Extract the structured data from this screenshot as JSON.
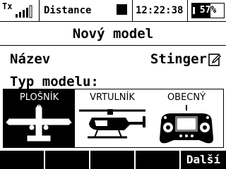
{
  "status": {
    "tx_label": "Tx",
    "signal_bars": 4,
    "title": "Distance",
    "clock": "12:22:38",
    "battery_percent": "57%",
    "battery_level": 0.57
  },
  "screen": {
    "title": "Nový model"
  },
  "model": {
    "name_label": "Název",
    "name_value": "Stinger"
  },
  "model_type": {
    "label": "Typ modelu:",
    "selected": "PLOŠNÍK",
    "options": [
      {
        "label": "PLOŠNÍK",
        "icon": "airplane-icon"
      },
      {
        "label": "VRTULNÍK",
        "icon": "helicopter-icon"
      },
      {
        "label": "OBECNÝ",
        "icon": "transmitter-icon"
      }
    ]
  },
  "footer": {
    "keys": [
      "",
      "",
      "",
      "",
      "Další"
    ]
  }
}
